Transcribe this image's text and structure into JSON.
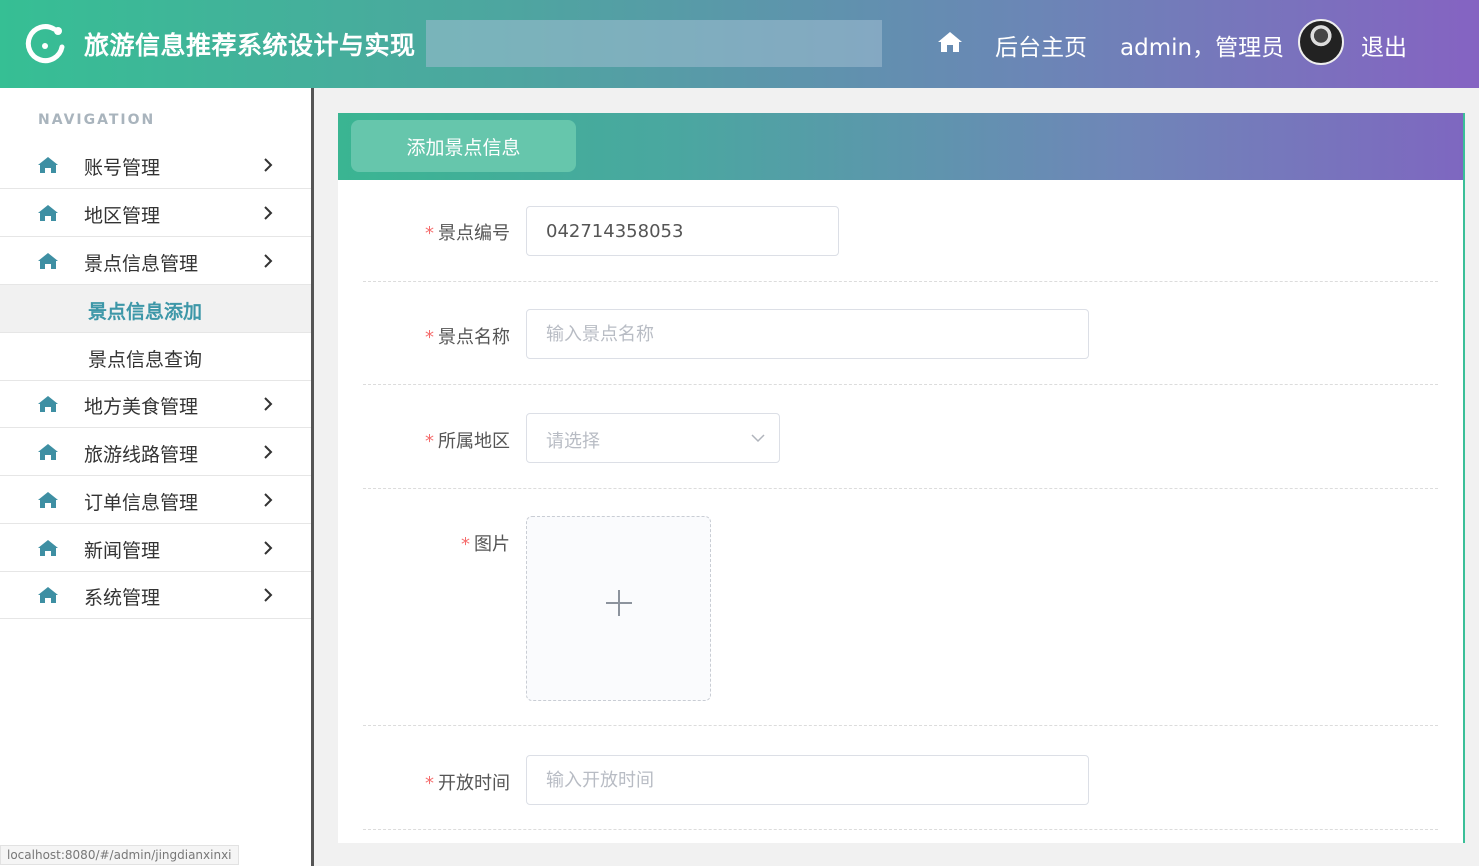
{
  "header": {
    "app_title": "旅游信息推荐系统设计与实现",
    "home_label": "后台主页",
    "user_label": "admin，管理员",
    "logout_label": "退出"
  },
  "sidebar": {
    "heading": "NAVIGATION",
    "items": [
      {
        "label": "账号管理"
      },
      {
        "label": "地区管理"
      },
      {
        "label": "景点信息管理"
      },
      {
        "label": "地方美食管理"
      },
      {
        "label": "旅游线路管理"
      },
      {
        "label": "订单信息管理"
      },
      {
        "label": "新闻管理"
      },
      {
        "label": "系统管理"
      }
    ],
    "sub_items": [
      {
        "label": "景点信息添加",
        "active": true
      },
      {
        "label": "景点信息查询",
        "active": false
      }
    ]
  },
  "panel": {
    "title": "添加景点信息",
    "fields": {
      "code": {
        "label": "景点编号",
        "value": "042714358053",
        "required": true
      },
      "name": {
        "label": "景点名称",
        "placeholder": "输入景点名称",
        "required": true
      },
      "region": {
        "label": "所属地区",
        "placeholder": "请选择",
        "required": true
      },
      "image": {
        "label": "图片",
        "required": true
      },
      "open_time": {
        "label": "开放时间",
        "placeholder": "输入开放时间",
        "required": true
      }
    },
    "required_mark": "*"
  },
  "status_bar": {
    "url": "localhost:8080/#/admin/jingdianxinxi"
  },
  "colors": {
    "accent": "#3d97a8",
    "gradient_start": "#36bf94",
    "gradient_end": "#8563c2",
    "required": "#f56c6c"
  },
  "icons": {
    "logo": "refresh-logo-icon",
    "home": "home-icon",
    "nav": "house-icon",
    "chevron": "chevron-right-icon",
    "select": "chevron-down-icon",
    "upload": "plus-icon"
  }
}
